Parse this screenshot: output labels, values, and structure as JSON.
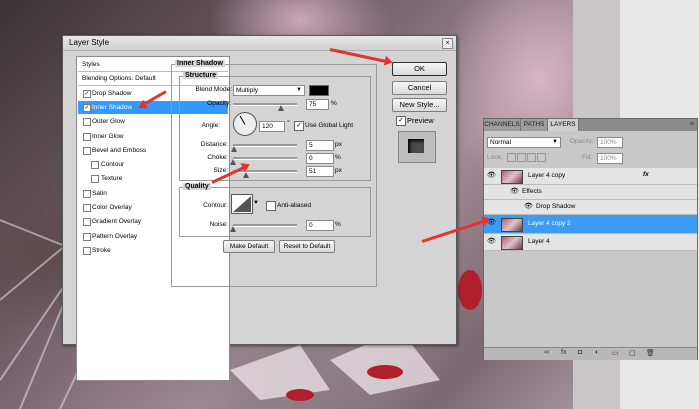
{
  "dialog": {
    "title": "Layer Style",
    "close_glyph": "×",
    "style_list": [
      {
        "label": "Styles",
        "checkbox": false,
        "checked": false,
        "selected": false,
        "indent": false
      },
      {
        "label": "Blending Options: Default",
        "checkbox": false,
        "checked": false,
        "selected": false,
        "indent": false
      },
      {
        "label": "Drop Shadow",
        "checkbox": true,
        "checked": true,
        "selected": false,
        "indent": false
      },
      {
        "label": "Inner Shadow",
        "checkbox": true,
        "checked": true,
        "selected": true,
        "indent": false
      },
      {
        "label": "Outer Glow",
        "checkbox": true,
        "checked": false,
        "selected": false,
        "indent": false
      },
      {
        "label": "Inner Glow",
        "checkbox": true,
        "checked": false,
        "selected": false,
        "indent": false
      },
      {
        "label": "Bevel and Emboss",
        "checkbox": true,
        "checked": false,
        "selected": false,
        "indent": false
      },
      {
        "label": "Contour",
        "checkbox": true,
        "checked": false,
        "selected": false,
        "indent": true
      },
      {
        "label": "Texture",
        "checkbox": true,
        "checked": false,
        "selected": false,
        "indent": true
      },
      {
        "label": "Satin",
        "checkbox": true,
        "checked": false,
        "selected": false,
        "indent": false
      },
      {
        "label": "Color Overlay",
        "checkbox": true,
        "checked": false,
        "selected": false,
        "indent": false
      },
      {
        "label": "Gradient Overlay",
        "checkbox": true,
        "checked": false,
        "selected": false,
        "indent": false
      },
      {
        "label": "Pattern Overlay",
        "checkbox": true,
        "checked": false,
        "selected": false,
        "indent": false
      },
      {
        "label": "Stroke",
        "checkbox": true,
        "checked": false,
        "selected": false,
        "indent": false
      }
    ],
    "inner_shadow": {
      "section_title": "Inner Shadow",
      "structure_title": "Structure",
      "blend_mode_label": "Blend Mode:",
      "blend_mode_value": "Multiply",
      "blend_color": "#000000",
      "opacity_label": "Opacity:",
      "opacity_value": "75",
      "opacity_unit": "%",
      "opacity_level": 0.75,
      "angle_label": "Angle:",
      "angle_value": "120",
      "angle_unit": "°",
      "use_global_light_label": "Use Global Light",
      "use_global_light_checked": true,
      "distance_label": "Distance:",
      "distance_value": "5",
      "distance_unit": "px",
      "distance_level": 0.02,
      "choke_label": "Choke:",
      "choke_value": "0",
      "choke_unit": "%",
      "choke_level": 0.0,
      "size_label": "Size:",
      "size_value": "51",
      "size_unit": "px",
      "size_level": 0.2,
      "quality_title": "Quality",
      "contour_label": "Contour:",
      "anti_aliased_label": "Anti-aliased",
      "anti_aliased_checked": false,
      "noise_label": "Noise:",
      "noise_value": "0",
      "noise_unit": "%",
      "noise_level": 0.0,
      "make_default_label": "Make Default",
      "reset_default_label": "Reset to Default"
    },
    "buttons": {
      "ok_label": "OK",
      "cancel_label": "Cancel",
      "new_style_label": "New Style...",
      "preview_label": "Preview",
      "preview_checked": true
    }
  },
  "layers_panel": {
    "tabs": [
      {
        "label": "CHANNELS",
        "active": false
      },
      {
        "label": "PATHS",
        "active": false
      },
      {
        "label": "LAYERS",
        "active": true
      }
    ],
    "blend_mode": "Normal",
    "opacity_label": "Opacity:",
    "opacity_value": "100%",
    "lock_label": "Lock:",
    "fill_label": "Fill:",
    "fill_value": "100%",
    "layers": [
      {
        "name": "Layer 4 copy",
        "fx": "fx",
        "selected": false
      },
      {
        "name": "Layer 4 copy 2",
        "fx": "",
        "selected": true
      },
      {
        "name": "Layer 4",
        "fx": "",
        "selected": false
      }
    ],
    "effects_label": "Effects",
    "drop_shadow_label": "Drop Shadow",
    "footer_icons": [
      "link-icon",
      "fx-icon",
      "mask-icon",
      "adjustment-icon",
      "group-icon",
      "new-layer-icon",
      "trash-icon"
    ]
  },
  "accent_color": "#3399ff",
  "arrow_color": "#e2342c"
}
